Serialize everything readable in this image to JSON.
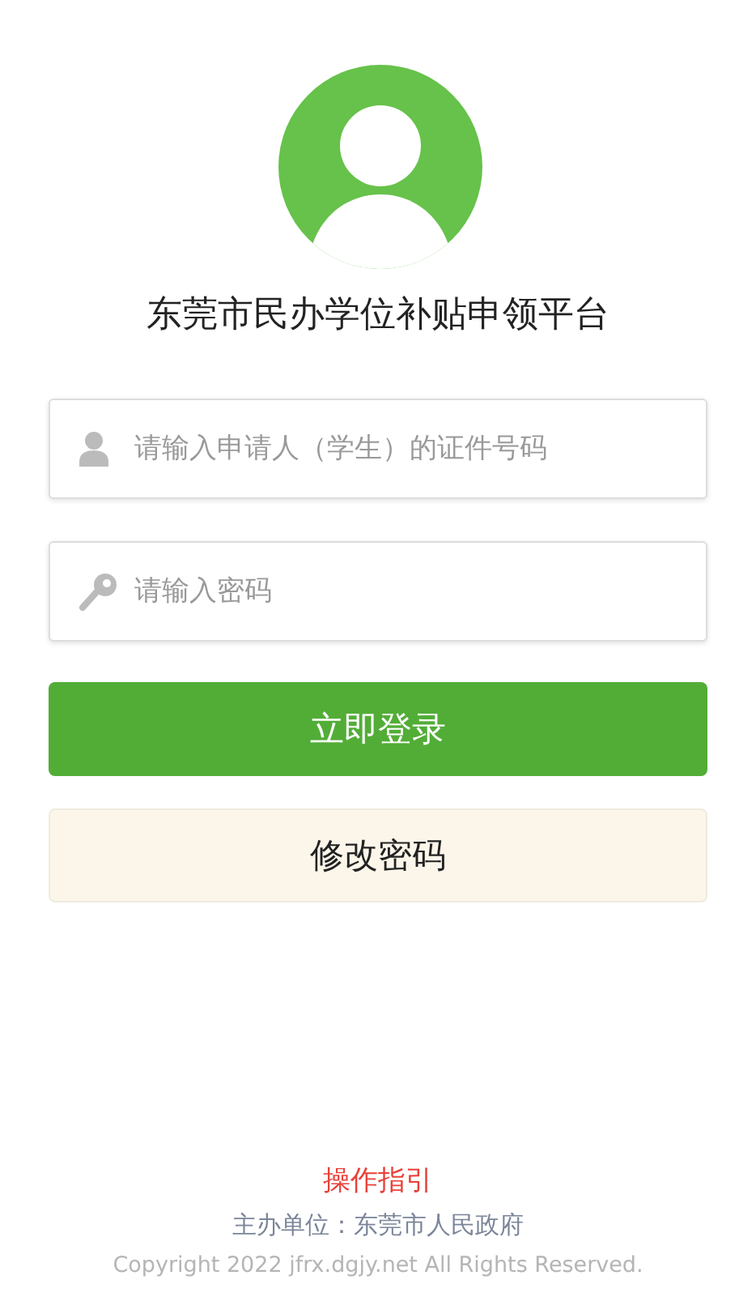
{
  "title": "东莞市民办学位补贴申领平台",
  "fields": [
    {
      "kind": "user",
      "placeholder": "请输入申请人（学生）的证件号码"
    },
    {
      "kind": "password",
      "placeholder": "请输入密码"
    }
  ],
  "buttons": [
    {
      "kind": "primary",
      "label": "立即登录"
    },
    {
      "kind": "secondary",
      "label": "修改密码"
    }
  ],
  "footer": {
    "guide_link": "操作指引",
    "organizer": "主办单位：东莞市人民政府",
    "copyright": "Copyright 2022 jfrx.dgjy.net All Rights Reserved."
  }
}
